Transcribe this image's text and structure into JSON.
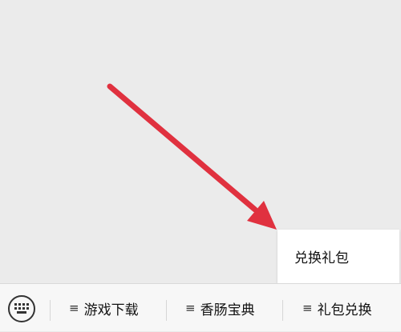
{
  "popup": {
    "items": [
      {
        "label": "兑换礼包"
      }
    ]
  },
  "bottom_bar": {
    "keyboard_icon": "keyboard-icon",
    "menu_icon": "menu-lines-icon",
    "menu_glyph": "≡",
    "menus": [
      {
        "label": "游戏下载"
      },
      {
        "label": "香肠宝典"
      },
      {
        "label": "礼包兑换"
      }
    ]
  },
  "colors": {
    "annotation_arrow": "#e0313f",
    "background": "#ebebeb",
    "bar_background": "#f7f7f7"
  }
}
